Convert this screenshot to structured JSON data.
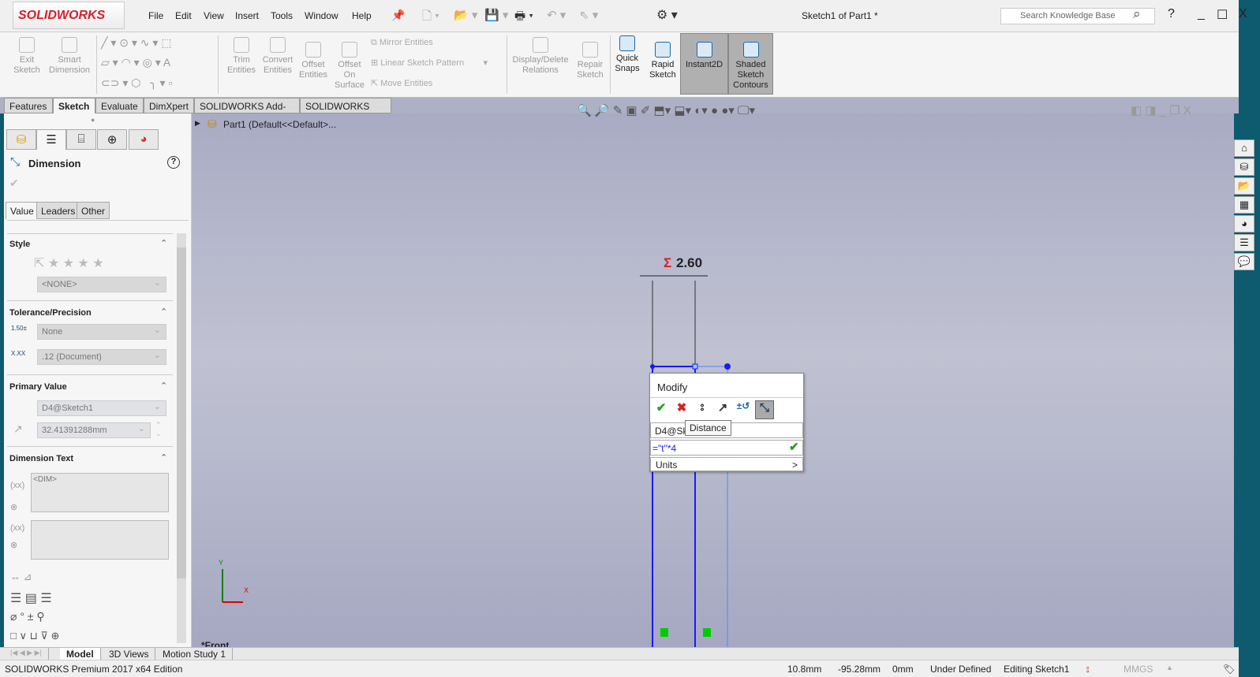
{
  "app": {
    "logo": "SOLIDWORKS",
    "title": "Sketch1 of Part1 *"
  },
  "menu": [
    "File",
    "Edit",
    "View",
    "Insert",
    "Tools",
    "Window",
    "Help"
  ],
  "search": {
    "placeholder": "Search Knowledge Base"
  },
  "window_controls": {
    "help": "?",
    "minimize": "_",
    "maximize": "☐",
    "close": "X"
  },
  "ribbon": {
    "exit_sketch": "Exit Sketch",
    "smart_dimension": "Smart Dimension",
    "trim": "Trim Entities",
    "convert": "Convert Entities",
    "offset": "Offset Entities",
    "offset_surface": "Offset On Surface",
    "mirror": "Mirror Entities",
    "linear_pattern": "Linear Sketch Pattern",
    "move": "Move Entities",
    "display_relations": "Display/Delete Relations",
    "repair": "Repair Sketch",
    "quick_snaps": "Quick Snaps",
    "rapid_sketch": "Rapid Sketch",
    "instant2d": "Instant2D",
    "shaded_contours": "Shaded Sketch Contours"
  },
  "command_tabs": [
    "Features",
    "Sketch",
    "Evaluate",
    "DimXpert",
    "SOLIDWORKS Add-Ins",
    "SOLIDWORKS MBD"
  ],
  "active_command_tab": "Sketch",
  "tree": {
    "root": "Part1  (Default<<Default>..."
  },
  "property_manager": {
    "title": "Dimension",
    "help": "?",
    "tabs": [
      "Value",
      "Leaders",
      "Other"
    ],
    "style": {
      "label": "Style",
      "value": "<NONE>"
    },
    "tolerance": {
      "label": "Tolerance/Precision",
      "tolerance_type": "None",
      "precision": ".12 (Document)"
    },
    "primary_value": {
      "label": "Primary Value",
      "name": "D4@Sketch1",
      "value": "32.41391288mm"
    },
    "dimension_text": {
      "label": "Dimension Text",
      "text": "<DIM>"
    }
  },
  "sketch": {
    "dimension_label": "2.60",
    "sigma": "Σ",
    "view_label": "*Front",
    "axis_x": "X",
    "axis_y": "Y"
  },
  "modify": {
    "title": "Modify",
    "tooltip": "Distance",
    "name_field": "D4@Sk",
    "equation": "=\"t\"*4",
    "units": "Units",
    "units_arrow": ">"
  },
  "bottom_tabs": [
    "Model",
    "3D Views",
    "Motion Study 1"
  ],
  "status": {
    "edition": "SOLIDWORKS Premium 2017 x64 Edition",
    "x": "10.8mm",
    "y": "-95.28mm",
    "z": "0mm",
    "state": "Under Defined",
    "editing": "Editing Sketch1",
    "units": "MMGS"
  },
  "colors": {
    "sketch_blue": "#1a1aff",
    "accent_red": "#d4202a",
    "viewport": "#b0b2c8"
  }
}
